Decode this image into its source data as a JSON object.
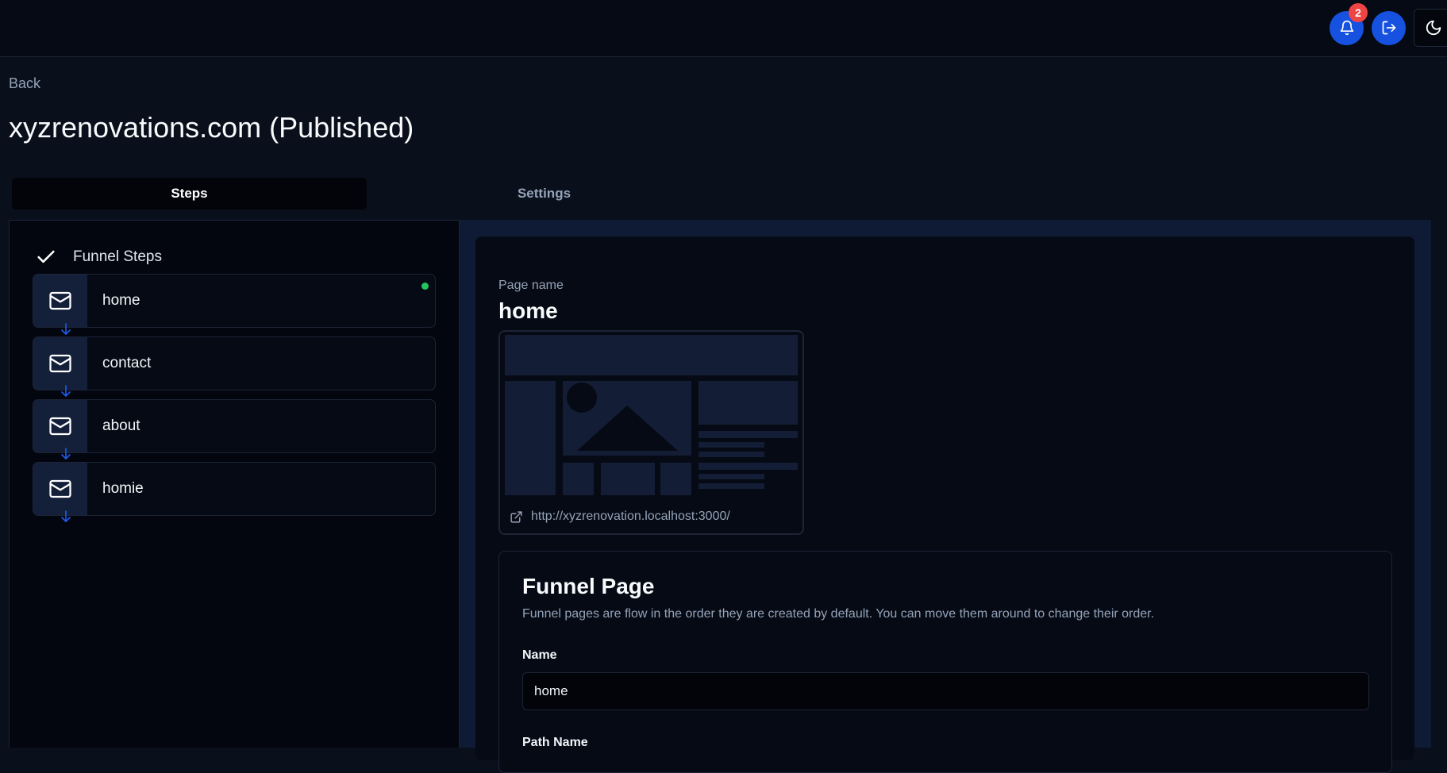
{
  "header": {
    "notifications_count": "2",
    "icons": {
      "notifications": "bell-icon",
      "logout": "logout-icon",
      "theme": "moon-icon"
    },
    "accent_color": "#1651e0",
    "badge_color": "#ef4444"
  },
  "page": {
    "back_label": "Back",
    "title": "xyzrenovations.com (Published)"
  },
  "tabs": [
    {
      "label": "Steps",
      "active": true
    },
    {
      "label": "Settings",
      "active": false
    }
  ],
  "steps_panel": {
    "header": "Funnel Steps",
    "header_icon": "check-icon",
    "items": [
      {
        "label": "home",
        "icon": "mail-icon",
        "selected": true
      },
      {
        "label": "contact",
        "icon": "mail-icon",
        "selected": false
      },
      {
        "label": "about",
        "icon": "mail-icon",
        "selected": false
      },
      {
        "label": "homie",
        "icon": "mail-icon",
        "selected": false
      }
    ],
    "active_dot_color": "#22c55e"
  },
  "detail": {
    "page_name_label": "Page name",
    "page_name": "home",
    "preview_link": "http://xyzrenovation.localhost:3000/",
    "form": {
      "title": "Funnel Page",
      "description": "Funnel pages are flow in the order they are created by default. You can move them around to change their order.",
      "name_label": "Name",
      "name_value": "home",
      "path_label": "Path Name"
    }
  }
}
